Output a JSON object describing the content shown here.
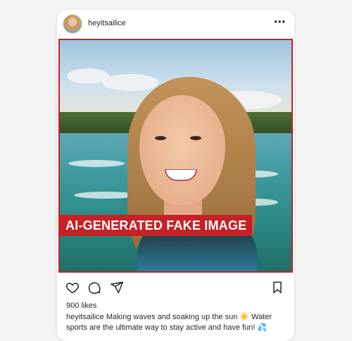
{
  "post": {
    "username": "heyitsailice",
    "badge_text": "AI-GENERATED FAKE IMAGE",
    "likes": "900 likes",
    "caption_username": "heyitsailice",
    "caption_text": " Making waves and soaking up the sun ☀️ Water sports are the ultimate way to stay active and have fun! 💦"
  },
  "icons": {
    "more": "more-options-icon",
    "like": "heart-icon",
    "comment": "comment-icon",
    "share": "share-icon",
    "save": "bookmark-icon"
  },
  "colors": {
    "badge": "#c52127",
    "card": "#ffffff",
    "background": "#f4f4f4"
  }
}
